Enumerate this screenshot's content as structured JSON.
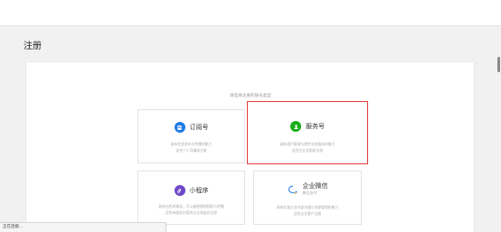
{
  "page": {
    "title": "注册"
  },
  "register": {
    "prompt": "请选择注册的账号类型",
    "types": [
      {
        "name": "订阅号",
        "icon": "subscription-icon",
        "color": "#1e7be6",
        "desc": [
          "具有信息发布与传播的能力",
          "适合个人及媒体注册"
        ],
        "selected": false
      },
      {
        "name": "服务号",
        "icon": "service-icon",
        "color": "#1aad19",
        "desc": [
          "具有用户管理与提供业务服务的能力",
          "适合企业及组织注册"
        ],
        "selected": true
      },
      {
        "name": "小程序",
        "icon": "miniprogram-icon",
        "color": "#6d47c9",
        "desc": [
          "具有出色的体验，可以被便捷地获取与传播",
          "适合有服务内容的企业和组织注册"
        ],
        "selected": false
      },
      {
        "name": "企业微信",
        "sub": "原企业号",
        "icon": "wework-icon",
        "color": "#2f86e0",
        "desc": [
          "具有实现企业内部沟通与内部管理的能力",
          "适合企业客户注册"
        ],
        "selected": false
      }
    ]
  },
  "status": {
    "text": "正在连接..."
  }
}
